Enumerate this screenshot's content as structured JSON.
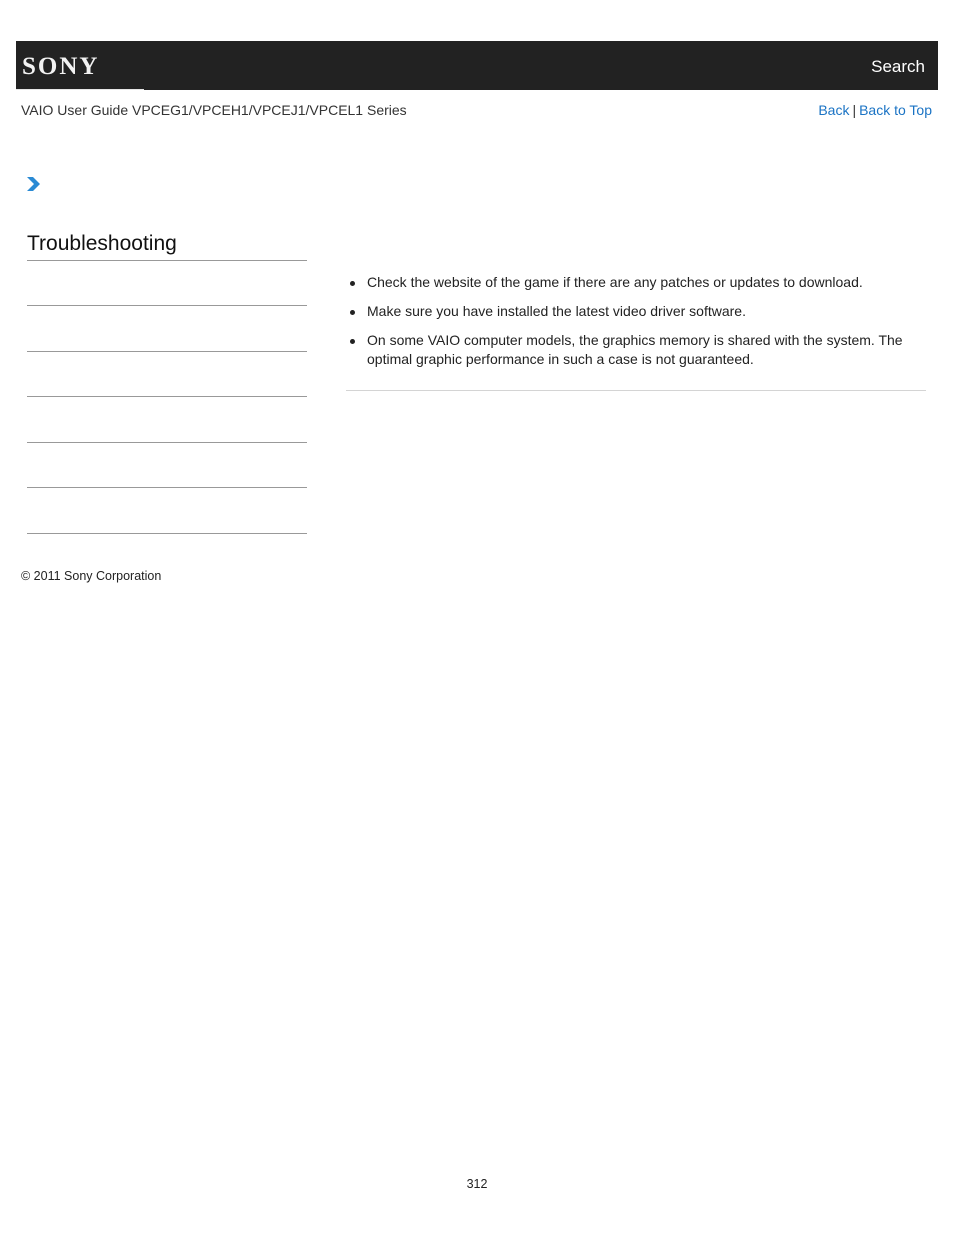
{
  "header": {
    "logo": "SONY",
    "search_label": "Search"
  },
  "subheader": {
    "guide_title": "VAIO User Guide VPCEG1/VPCEH1/VPCEJ1/VPCEL1 Series",
    "back_label": "Back",
    "separator": "|",
    "back_to_top_label": "Back to Top"
  },
  "icons": {
    "chevron": "chevron-right-icon",
    "chevron_color": "#2a8ad4"
  },
  "sidebar": {
    "title": "Troubleshooting",
    "items": [
      "",
      "",
      "",
      "",
      "",
      ""
    ]
  },
  "content": {
    "bullets": [
      "Check the website of the game if there are any patches or updates to download.",
      "Make sure you have installed the latest video driver software.",
      "On some VAIO computer models, the graphics memory is shared with the system. The optimal graphic performance in such a case is not guaranteed."
    ]
  },
  "footer": {
    "copyright": "© 2011 Sony Corporation",
    "page_number": "312"
  },
  "colors": {
    "header_bg": "#222222",
    "link": "#1a73c4"
  }
}
